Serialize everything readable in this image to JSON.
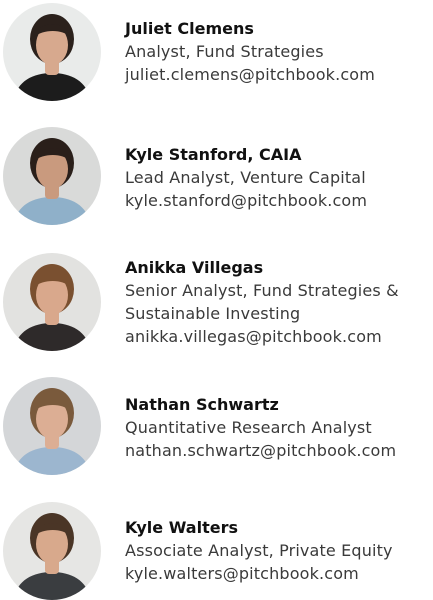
{
  "contacts": [
    {
      "name": "Juliet Clemens",
      "title_lines": [
        "Analyst, Fund Strategies"
      ],
      "email": "juliet.clemens@pitchbook.com",
      "avatar": {
        "bg": "#e9ebea",
        "hair": "#2b211c",
        "skin": "#d7a98e",
        "shirt": "#1c1c1c"
      }
    },
    {
      "name": "Kyle Stanford, CAIA",
      "title_lines": [
        "Lead Analyst, Venture Capital"
      ],
      "email": "kyle.stanford@pitchbook.com",
      "avatar": {
        "bg": "#d9dad9",
        "hair": "#2a1f1a",
        "skin": "#c99a7e",
        "shirt": "#8fb0c9"
      }
    },
    {
      "name": "Anikka Villegas",
      "title_lines": [
        "Senior Analyst, Fund Strategies &",
        "Sustainable Investing"
      ],
      "email": "anikka.villegas@pitchbook.com",
      "avatar": {
        "bg": "#e2e2e0",
        "hair": "#7a5030",
        "skin": "#d9a88c",
        "shirt": "#2e2a2a"
      }
    },
    {
      "name": "Nathan Schwartz",
      "title_lines": [
        "Quantitative Research Analyst"
      ],
      "email": "nathan.schwartz@pitchbook.com",
      "avatar": {
        "bg": "#d4d6d8",
        "hair": "#7a5a3c",
        "skin": "#dcae94",
        "shirt": "#9cb6cf"
      }
    },
    {
      "name": "Kyle Walters",
      "title_lines": [
        "Associate Analyst, Private Equity"
      ],
      "email": "kyle.walters@pitchbook.com",
      "avatar": {
        "bg": "#e6e6e4",
        "hair": "#4a3526",
        "skin": "#d8a98c",
        "shirt": "#3a3d40"
      }
    }
  ]
}
